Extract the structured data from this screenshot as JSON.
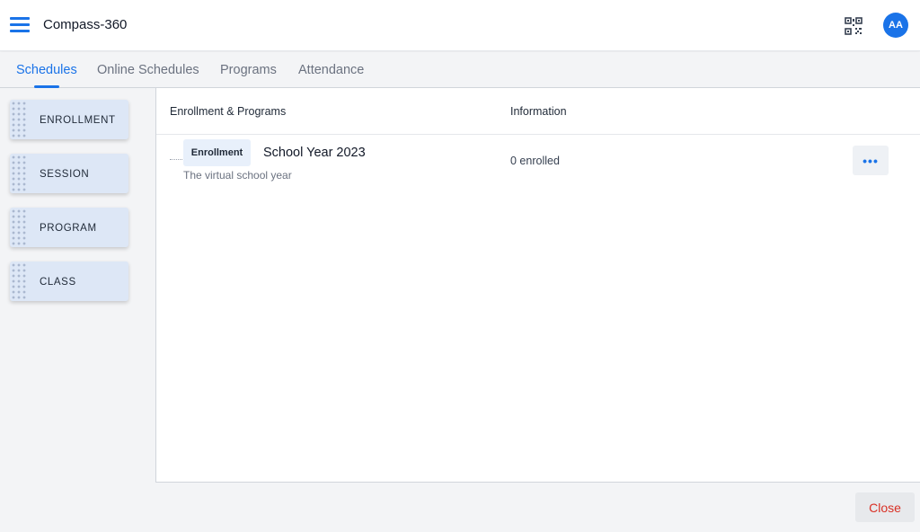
{
  "app": {
    "title": "Compass-360",
    "avatar_initials": "AA",
    "accent_color": "#1a73e8",
    "icons": {
      "menu": "hamburger-menu-icon",
      "qr": "qr-code-icon"
    }
  },
  "tabs": [
    {
      "label": "Schedules",
      "active": true
    },
    {
      "label": "Online Schedules",
      "active": false
    },
    {
      "label": "Programs",
      "active": false
    },
    {
      "label": "Attendance",
      "active": false
    }
  ],
  "sidebar": {
    "items": [
      {
        "label": "ENROLLMENT"
      },
      {
        "label": "SESSION"
      },
      {
        "label": "PROGRAM"
      },
      {
        "label": "CLASS"
      }
    ]
  },
  "table": {
    "headers": {
      "enrollment": "Enrollment & Programs",
      "information": "Information"
    },
    "rows": [
      {
        "badge": "Enrollment",
        "title": "School Year 2023",
        "subtitle": "The virtual school year",
        "info": "0 enrolled",
        "action_glyph": "•••"
      }
    ]
  },
  "footer": {
    "close_label": "Close",
    "close_color": "#d93025"
  }
}
